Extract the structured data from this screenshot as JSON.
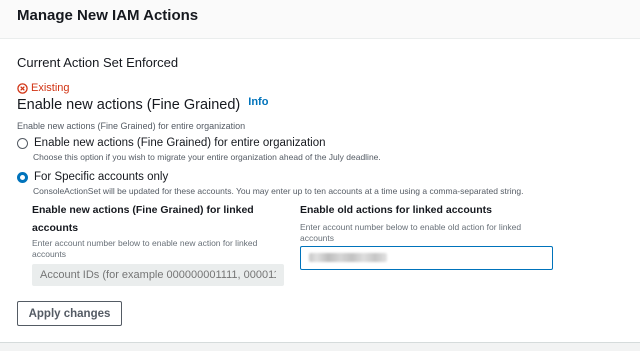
{
  "header": {
    "title": "Manage New IAM Actions"
  },
  "section": {
    "title": "Current Action Set Enforced"
  },
  "status": {
    "icon": "error-circle-icon",
    "label": "Existing",
    "color": "#d13212"
  },
  "field": {
    "label": "Enable new actions (Fine Grained)",
    "info_link": "Info",
    "description": "Enable new actions (Fine Grained) for entire organization"
  },
  "options": [
    {
      "label": "Enable new actions (Fine Grained) for entire organization",
      "description": "Choose this option if you wish to migrate your entire organization ahead of the July deadline.",
      "selected": false
    },
    {
      "label": "For Specific accounts only",
      "description": "ConsoleActionSet will be updated for these accounts. You may enter up to ten accounts at a time using a comma-separated string.",
      "selected": true
    }
  ],
  "linked": {
    "new": {
      "label_line1": "Enable new actions (Fine Grained) for linked",
      "label_line2": "accounts",
      "desc_line1": "Enter account number below to enable new action for linked",
      "desc_line2": "accounts",
      "placeholder": "Account IDs (for example 000000001111, 000011"
    },
    "old": {
      "label": "Enable old actions for linked accounts",
      "desc_line1": "Enter account number below to enable old action for linked",
      "desc_line2": "accounts"
    }
  },
  "actions": {
    "apply": "Apply changes"
  },
  "colors": {
    "accent": "#0073bb",
    "error": "#d13212"
  }
}
